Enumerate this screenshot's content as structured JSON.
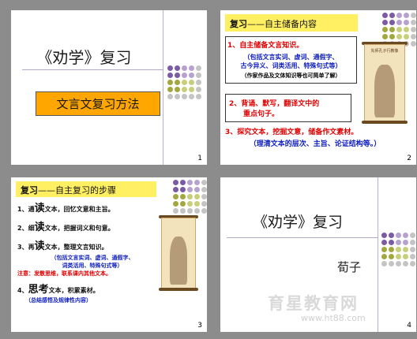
{
  "slides": [
    {
      "number": "1",
      "title": "《劝学》复习",
      "box_label": "文言文复习方法"
    },
    {
      "number": "2",
      "heading_bold": "复习",
      "heading_rest": "——自主储备内容",
      "item1_title": "1、自主储备文言知识。",
      "item1_detail_a": "（包括文言实词、虚词、通假字、",
      "item1_detail_b": "古今异义、词类活用、特殊句式等）",
      "item1_note": "（作家作品及文体知识等也可简单了解）",
      "item2_a": "2、背诵、默写，翻译文中的",
      "item2_b": "重点句子。",
      "item3": "3、探究文本，挖掘文意，储备作文素材。",
      "item3_detail": "（理清文本的层次、主旨、论证结构等。）"
    },
    {
      "number": "3",
      "heading_bold": "复习",
      "heading_rest": "——自主复习的步骤",
      "steps": [
        {
          "pre": "1、通",
          "big": "读",
          "post": "文本，回忆文意和主旨。"
        },
        {
          "pre": "2、细",
          "big": "读",
          "post": "文本，把握词义和句意。"
        },
        {
          "pre": "3、再",
          "big": "读",
          "post": "文本，整理文言知识。"
        }
      ],
      "sub_a": "（包括文言实词、虚词、通假字、",
      "sub_b": "词类活用、特殊句式等）",
      "note": "注意：发散思维，联系课内其他文本。",
      "step4": {
        "pre": "4、",
        "big": "思考",
        "post": "文本，积累素材。"
      },
      "step4_detail": "（总结感悟及规律性内容）"
    },
    {
      "number": "4",
      "title": "《劝学》复习",
      "author": "荀子"
    }
  ],
  "watermark": "育星教育网",
  "watermark_url": "www.ht88.com",
  "scroll_caption": "先师孔子行教像",
  "colors": {
    "purple": "#7d5aa6",
    "lilac": "#b6a2d0",
    "olive": "#a3a83e",
    "khaki": "#c8cf7a",
    "grey": "#c4c4c4",
    "orange": "#ffa600",
    "yellow": "#ffef63"
  }
}
